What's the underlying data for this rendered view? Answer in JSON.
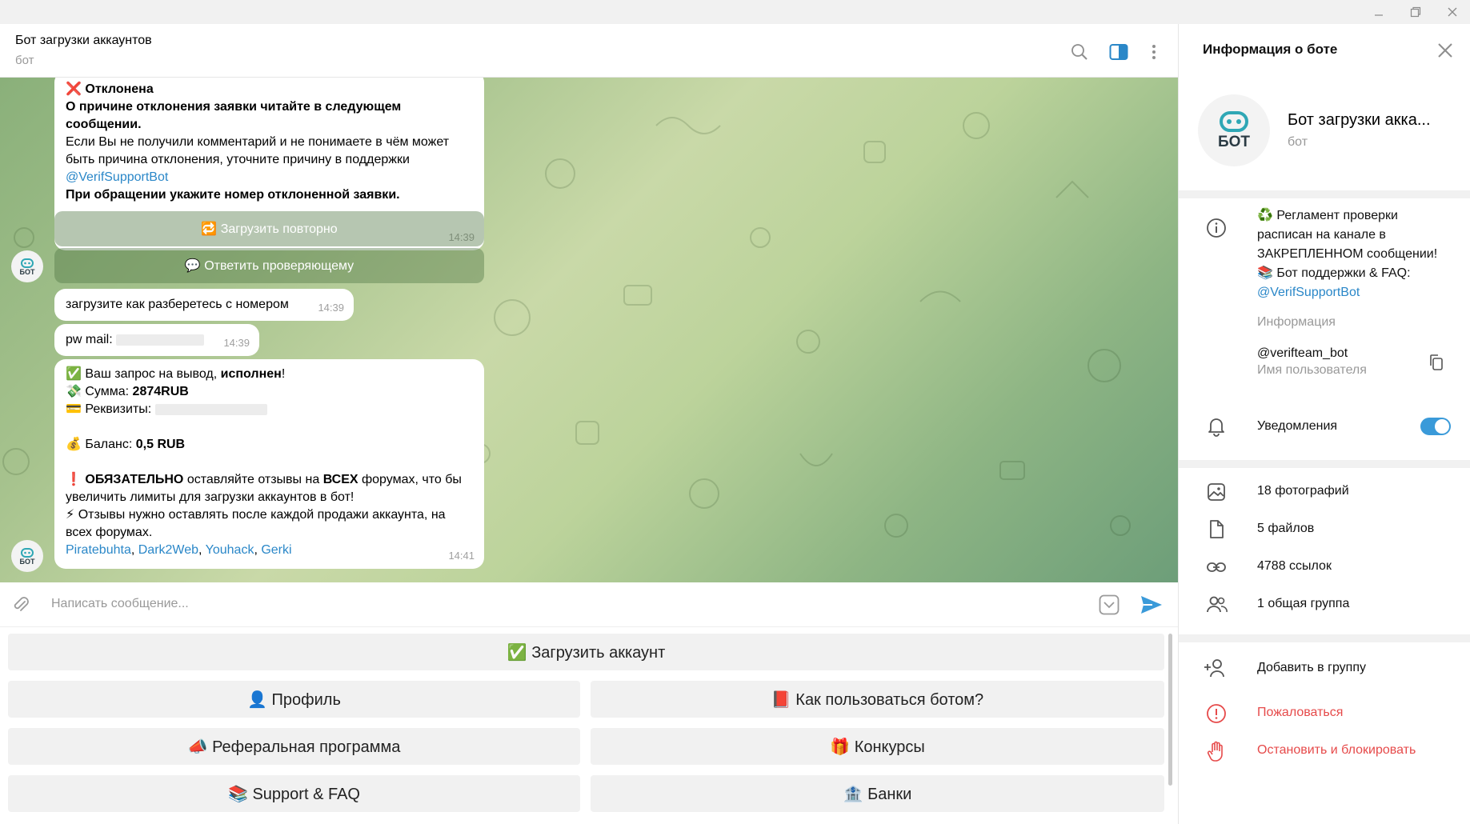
{
  "window": {
    "minimize_icon": "minimize-icon",
    "maximize_icon": "restore-icon",
    "close_icon": "close-icon"
  },
  "chat": {
    "title": "Бот загрузки аккаунтов",
    "subtitle": "бот"
  },
  "avatar_label": "БОТ",
  "messages": {
    "m1": {
      "status_emoji": "❌",
      "status": "Отклонена",
      "line1": "О причине отклонения заявки читайте в следующем сообщении.",
      "line2": "Если Вы не получили комментарий и не понимаете в чём может быть причина отклонения, уточните причину в поддержки",
      "link": "@VerifSupportBot",
      "line3": "При обращении укажите номер отклоненной заявки.",
      "time": "14:39",
      "button1": "🔁 Загрузить повторно",
      "button2": "💬 Ответить проверяющему"
    },
    "m2": {
      "text": "загрузите как разберетесь с номером",
      "time": "14:39"
    },
    "m3": {
      "text": "pw mail:",
      "time": "14:39"
    },
    "m4": {
      "line1_emoji": "✅",
      "line1_a": "Ваш запрос на вывод,",
      "line1_b": "исполнен",
      "line1_c": "!",
      "line2_emoji": "💸",
      "line2_a": "Сумма:",
      "line2_b": "2874RUB",
      "line3_emoji": "💳",
      "line3_a": "Реквизиты:",
      "line4_emoji": "💰",
      "line4_a": "Баланс:",
      "line4_b": "0,5 RUB",
      "line5_emoji": "❗",
      "line5_a": "ОБЯЗАТЕЛЬНО",
      "line5_b": "оставляйте отзывы на",
      "line5_c": "ВСЕХ",
      "line5_d": "форумах, что бы увеличить лимиты для загрузки аккаунтов в бот!",
      "line6_emoji": "⚡",
      "line6_a": "Отзывы нужно оставлять после каждой продажи аккаунта, на всех форумах.",
      "links": [
        "Piratebuhta",
        "Dark2Web",
        "Youhack",
        "Gerki"
      ],
      "sep": ", ",
      "time": "14:41"
    }
  },
  "composer": {
    "placeholder": "Написать сообщение..."
  },
  "keyboard": {
    "row1": "✅ Загрузить аккаунт",
    "row2_left": "👤 Профиль",
    "row2_right": "📕 Как пользоваться ботом?",
    "row3_left": "📣 Реферальная программа",
    "row3_right": "🎁 Конкурсы",
    "row4_left": "📚 Support & FAQ",
    "row4_right": "🏦 Банки"
  },
  "side": {
    "title": "Информация о боте",
    "name": "Бот загрузки акка...",
    "sub": "бот",
    "info_line1": "♻️ Регламент проверки расписан на канале в ЗАКРЕПЛЕННОМ сообщении!",
    "info_line2": "📚 Бот поддержки & FAQ:",
    "info_link": "@VerifSupportBot",
    "info_label": "Информация",
    "username": "@verifteam_bot",
    "username_label": "Имя пользователя",
    "notifications": "Уведомления",
    "notifications_on": true,
    "photos": "18 фотографий",
    "files": "5 файлов",
    "links": "4788 ссылок",
    "groups": "1 общая группа",
    "add_group": "Добавить в группу",
    "report": "Пожаловаться",
    "block": "Остановить и блокировать"
  }
}
